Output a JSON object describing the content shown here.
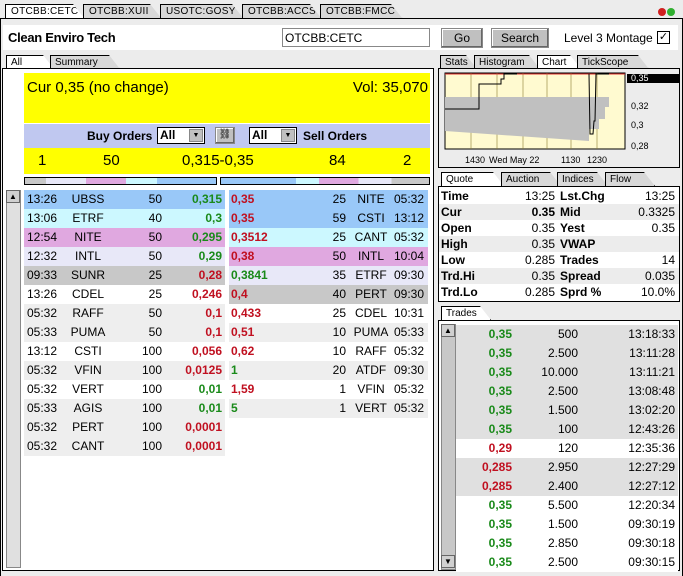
{
  "tabs": [
    {
      "label": "OTCBB:CETC",
      "active": true
    },
    {
      "label": "OTCBB:XUII"
    },
    {
      "label": "USOTC:GOSY"
    },
    {
      "label": "OTCBB:ACCS"
    },
    {
      "label": "OTCBB:FMCC"
    }
  ],
  "header": {
    "company": "Clean Enviro Tech",
    "symbol_value": "OTCBB:CETC",
    "go_label": "Go",
    "search_label": "Search",
    "montage_label": "Level 3 Montage",
    "montage_checked": true
  },
  "left_tabs": [
    "All orders",
    "Summary"
  ],
  "right_tabs": [
    "Stats",
    "Histogram",
    "Chart",
    "TickScope"
  ],
  "quote_tabs": [
    "Quote Info",
    "Auction",
    "Indices",
    "Flow"
  ],
  "trades_tab": "Trades",
  "summary": {
    "cur": "Cur 0,35 (no change)",
    "vol": "Vol: 35,070"
  },
  "filters": {
    "buy_label": "Buy Orders",
    "buy_value": "All",
    "sell_label": "Sell Orders",
    "sell_value": "All",
    "link_icon": "link-icon"
  },
  "inside": {
    "bid_count": "1",
    "bid_size": "50",
    "spread": "0,315-0,35",
    "ask_size": "84",
    "ask_count": "2"
  },
  "level_colors": [
    "#99c8f8",
    "#ccf8ff",
    "#e0a8e0",
    "#e8e8f8",
    "#c8c8c8",
    "#ffffff",
    "#eeeeee"
  ],
  "bids": [
    {
      "time": "13:26",
      "mm": "UBSS",
      "size": "50",
      "price": "0,315",
      "dir": "up",
      "lvl": 0
    },
    {
      "time": "13:06",
      "mm": "ETRF",
      "size": "40",
      "price": "0,3",
      "dir": "up",
      "lvl": 1
    },
    {
      "time": "12:54",
      "mm": "NITE",
      "size": "50",
      "price": "0,295",
      "dir": "up",
      "lvl": 2
    },
    {
      "time": "12:32",
      "mm": "INTL",
      "size": "50",
      "price": "0,29",
      "dir": "up",
      "lvl": 3
    },
    {
      "time": "09:33",
      "mm": "SUNR",
      "size": "25",
      "price": "0,28",
      "dir": "down",
      "lvl": 4
    },
    {
      "time": "13:26",
      "mm": "CDEL",
      "size": "25",
      "price": "0,246",
      "dir": "down",
      "lvl": 5
    },
    {
      "time": "05:32",
      "mm": "RAFF",
      "size": "50",
      "price": "0,1",
      "dir": "down",
      "lvl": 6
    },
    {
      "time": "05:33",
      "mm": "PUMA",
      "size": "50",
      "price": "0,1",
      "dir": "down",
      "lvl": 6
    },
    {
      "time": "13:12",
      "mm": "CSTI",
      "size": "100",
      "price": "0,056",
      "dir": "down",
      "lvl": 5
    },
    {
      "time": "05:32",
      "mm": "VFIN",
      "size": "100",
      "price": "0,0125",
      "dir": "down",
      "lvl": 6
    },
    {
      "time": "05:32",
      "mm": "VERT",
      "size": "100",
      "price": "0,01",
      "dir": "up",
      "lvl": 5
    },
    {
      "time": "05:33",
      "mm": "AGIS",
      "size": "100",
      "price": "0,01",
      "dir": "up",
      "lvl": 6
    },
    {
      "time": "05:32",
      "mm": "PERT",
      "size": "100",
      "price": "0,0001",
      "dir": "down",
      "lvl": 6
    },
    {
      "time": "05:32",
      "mm": "CANT",
      "size": "100",
      "price": "0,0001",
      "dir": "down",
      "lvl": 6
    }
  ],
  "asks": [
    {
      "price": "0,35",
      "dir": "down",
      "size": "25",
      "mm": "NITE",
      "time": "05:32",
      "lvl": 0
    },
    {
      "price": "0,35",
      "dir": "down",
      "size": "59",
      "mm": "CSTI",
      "time": "13:12",
      "lvl": 0
    },
    {
      "price": "0,3512",
      "dir": "down",
      "size": "25",
      "mm": "CANT",
      "time": "05:32",
      "lvl": 1
    },
    {
      "price": "0,38",
      "dir": "down",
      "size": "50",
      "mm": "INTL",
      "time": "10:04",
      "lvl": 2
    },
    {
      "price": "0,3841",
      "dir": "up",
      "size": "35",
      "mm": "ETRF",
      "time": "09:30",
      "lvl": 3
    },
    {
      "price": "0,4",
      "dir": "down",
      "size": "40",
      "mm": "PERT",
      "time": "09:30",
      "lvl": 4
    },
    {
      "price": "0,433",
      "dir": "down",
      "size": "25",
      "mm": "CDEL",
      "time": "10:31",
      "lvl": 5
    },
    {
      "price": "0,51",
      "dir": "down",
      "size": "10",
      "mm": "PUMA",
      "time": "05:33",
      "lvl": 6
    },
    {
      "price": "0,62",
      "dir": "down",
      "size": "10",
      "mm": "RAFF",
      "time": "05:32",
      "lvl": 5
    },
    {
      "price": "1",
      "dir": "up",
      "size": "20",
      "mm": "ATDF",
      "time": "09:30",
      "lvl": 6
    },
    {
      "price": "1,59",
      "dir": "down",
      "size": "1",
      "mm": "VFIN",
      "time": "05:32",
      "lvl": 5
    },
    {
      "price": "5",
      "dir": "up",
      "size": "1",
      "mm": "VERT",
      "time": "05:32",
      "lvl": 6
    }
  ],
  "chart": {
    "y_ticks": [
      "0,35",
      "0,32",
      "0,3",
      "0,28"
    ],
    "x_ticks": [
      "1430",
      "Wed May 22",
      "1130",
      "1230"
    ],
    "last": "0,35"
  },
  "quote": [
    [
      "Time",
      "13:25",
      "Lst.Chg",
      "13:25"
    ],
    [
      "Cur",
      "0.35",
      "Mid",
      "0.3325"
    ],
    [
      " Open",
      "0.35",
      "Yest",
      "0.35"
    ],
    [
      "High",
      "0.35",
      "VWAP",
      ""
    ],
    [
      "Low",
      "0.285",
      "Trades",
      "14"
    ],
    [
      "Trd.Hi",
      "0.35",
      "Spread",
      "0.035"
    ],
    [
      "Trd.Lo",
      "0.285",
      "Sprd %",
      "10.0%"
    ]
  ],
  "trades": [
    {
      "price": "0,35",
      "dir": "up",
      "size": "500",
      "time": "13:18:33",
      "shade": true
    },
    {
      "price": "0,35",
      "dir": "up",
      "size": "2.500",
      "time": "13:11:28",
      "shade": true
    },
    {
      "price": "0,35",
      "dir": "up",
      "size": "10.000",
      "time": "13:11:21",
      "shade": true
    },
    {
      "price": "0,35",
      "dir": "up",
      "size": "2.500",
      "time": "13:08:48",
      "shade": true
    },
    {
      "price": "0,35",
      "dir": "up",
      "size": "1.500",
      "time": "13:02:20",
      "shade": true
    },
    {
      "price": "0,35",
      "dir": "up",
      "size": "100",
      "time": "12:43:26",
      "shade": true
    },
    {
      "price": "0,29",
      "dir": "down",
      "size": "120",
      "time": "12:35:36",
      "shade": false
    },
    {
      "price": "0,285",
      "dir": "down",
      "size": "2.950",
      "time": "12:27:29",
      "shade": true
    },
    {
      "price": "0,285",
      "dir": "down",
      "size": "2.400",
      "time": "12:27:12",
      "shade": true
    },
    {
      "price": "0,35",
      "dir": "up",
      "size": "5.500",
      "time": "12:20:34",
      "shade": false
    },
    {
      "price": "0,35",
      "dir": "up",
      "size": "1.500",
      "time": "09:30:19",
      "shade": false
    },
    {
      "price": "0,35",
      "dir": "up",
      "size": "2.850",
      "time": "09:30:18",
      "shade": false
    },
    {
      "price": "0,35",
      "dir": "up",
      "size": "2.500",
      "time": "09:30:15",
      "shade": false
    }
  ]
}
